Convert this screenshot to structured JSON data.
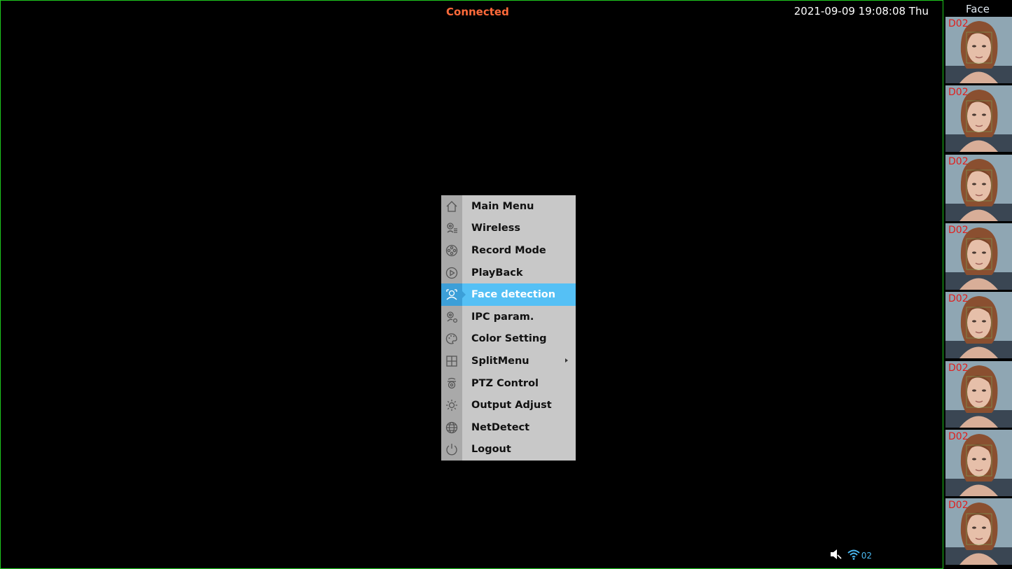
{
  "header": {
    "status": "Connected",
    "datetime": "2021-09-09 19:08:08 Thu"
  },
  "context_menu": {
    "selected": "Face detection",
    "items": [
      {
        "label": "Main Menu",
        "icon": "home-icon"
      },
      {
        "label": "Wireless",
        "icon": "wireless-camera-list-icon"
      },
      {
        "label": "Record Mode",
        "icon": "film-reel-icon"
      },
      {
        "label": "PlayBack",
        "icon": "play-circle-icon"
      },
      {
        "label": "Face detection",
        "icon": "face-scan-icon"
      },
      {
        "label": "IPC param.",
        "icon": "camera-settings-icon"
      },
      {
        "label": "Color Setting",
        "icon": "palette-icon"
      },
      {
        "label": "SplitMenu",
        "icon": "grid-split-icon",
        "has_submenu": true
      },
      {
        "label": "PTZ Control",
        "icon": "ptz-camera-icon"
      },
      {
        "label": "Output Adjust",
        "icon": "brightness-icon"
      },
      {
        "label": "NetDetect",
        "icon": "globe-icon"
      },
      {
        "label": "Logout",
        "icon": "power-icon"
      }
    ]
  },
  "status_bar": {
    "icons": [
      "speaker-muted-icon",
      "wifi-icon"
    ],
    "channel_count": "02"
  },
  "face_panel": {
    "title": "Face",
    "thumbnails": [
      {
        "tag": "D02"
      },
      {
        "tag": "D02"
      },
      {
        "tag": "D02"
      },
      {
        "tag": "D02"
      },
      {
        "tag": "D02"
      },
      {
        "tag": "D02"
      },
      {
        "tag": "D02"
      },
      {
        "tag": "D02"
      }
    ]
  },
  "colors": {
    "viewport_border": "#1ec81e",
    "status_text": "#ff6a3a",
    "menu_bg": "#c8c8c8",
    "menu_selected": "#55c0f5",
    "thumb_tag": "#e0201e"
  }
}
